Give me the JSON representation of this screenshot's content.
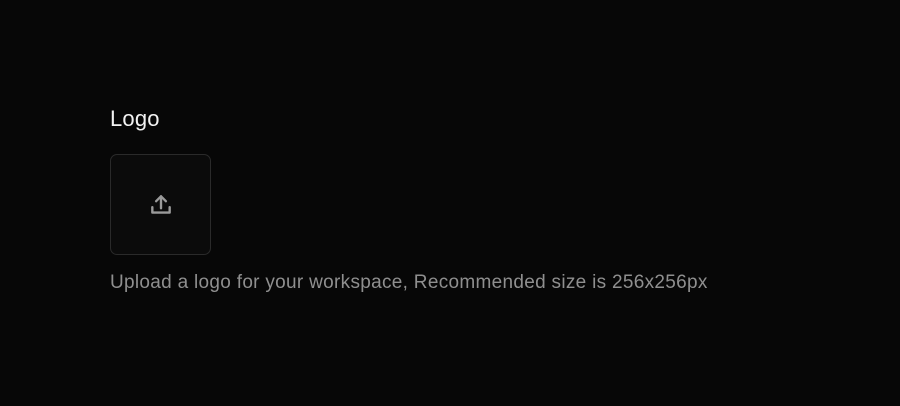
{
  "logo_field": {
    "title": "Logo",
    "upload_icon": "upload-icon",
    "help_text": "Upload a logo for your workspace, Recommended size is 256x256px"
  },
  "colors": {
    "background": "#070707",
    "title_text": "#f2f2f2",
    "help_text": "#8f8f8f",
    "box_border": "#2a2a2a",
    "icon": "#9a9a9a"
  }
}
